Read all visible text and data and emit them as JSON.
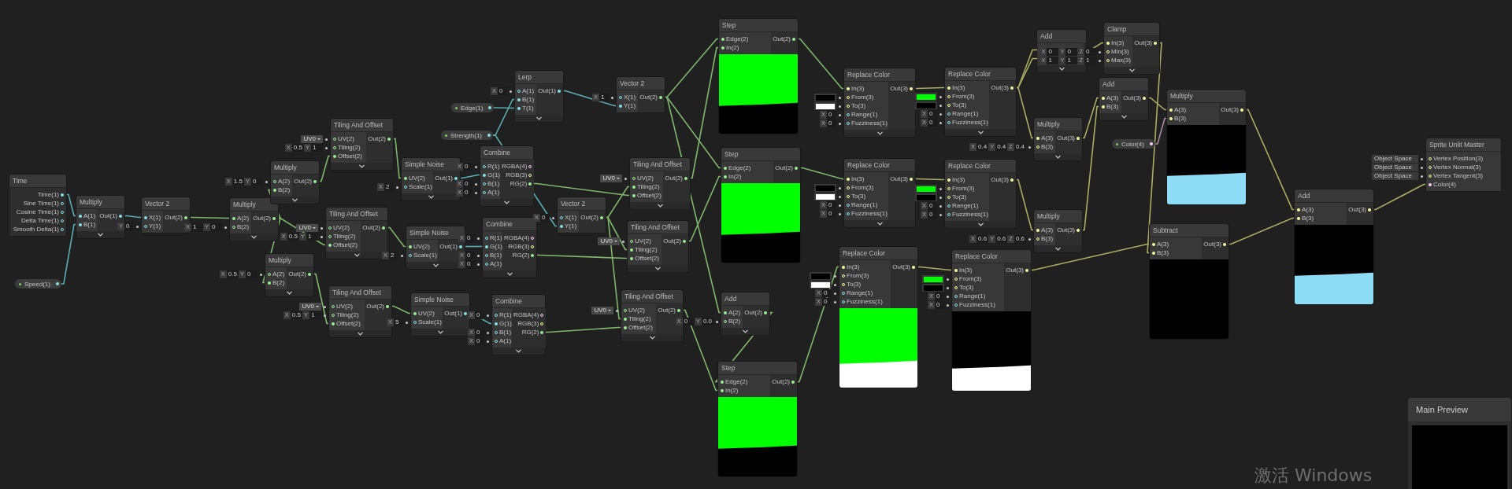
{
  "nodes": [
    {
      "title": "Time",
      "collapsible": false,
      "outputs": [
        {
          "label": "Time(1)",
          "kind": "float",
          "connected": true
        },
        {
          "label": "Sine Time(1)",
          "kind": "float",
          "connected": false
        },
        {
          "label": "Cosine Time(1)",
          "kind": "float",
          "connected": false
        },
        {
          "label": "Delta Time(1)",
          "kind": "float",
          "connected": false
        },
        {
          "label": "Smooth Delta(1)",
          "kind": "float",
          "connected": false
        }
      ]
    },
    {
      "title": "Multiply",
      "collapsible": true,
      "inputs": [
        {
          "label": "A(1)",
          "kind": "float",
          "connected": true
        },
        {
          "label": "B(1)",
          "kind": "float",
          "connected": true
        }
      ],
      "outputs": [
        {
          "label": "Out(1)",
          "kind": "float",
          "connected": true
        }
      ]
    },
    {
      "title": "Vector 2",
      "collapsible": false,
      "inputs": [
        {
          "label": "X(1)",
          "kind": "float",
          "connected": true
        },
        {
          "label": "Y(1)",
          "kind": "float",
          "connected": false,
          "field": {
            "kind": "vector",
            "parts": [
              {
                "axis": "Y",
                "value": "0"
              }
            ]
          }
        }
      ],
      "outputs": [
        {
          "label": "Out(2)",
          "kind": "vec2",
          "connected": true
        }
      ]
    },
    {
      "title": "Multiply",
      "collapsible": true,
      "inputs": [
        {
          "label": "A(2)",
          "kind": "vec2",
          "connected": true
        },
        {
          "label": "B(2)",
          "kind": "vec2",
          "connected": false,
          "field": {
            "kind": "vector",
            "parts": [
              {
                "axis": "X",
                "value": "1"
              },
              {
                "axis": "Y",
                "value": "0"
              }
            ]
          }
        }
      ],
      "outputs": [
        {
          "label": "Out(2)",
          "kind": "vec2",
          "connected": true
        }
      ]
    },
    {
      "title": "Multiply",
      "collapsible": true,
      "inputs": [
        {
          "label": "A(2)",
          "kind": "vec2",
          "connected": false,
          "field": {
            "kind": "vector",
            "parts": [
              {
                "axis": "X",
                "value": "1.5"
              },
              {
                "axis": "Y",
                "value": "0"
              }
            ]
          }
        },
        {
          "label": "B(2)",
          "kind": "vec2",
          "connected": true
        }
      ],
      "outputs": [
        {
          "label": "Out(2)",
          "kind": "vec2",
          "connected": true
        }
      ]
    },
    {
      "title": "Tiling And Offset",
      "collapsible": true,
      "inputs": [
        {
          "label": "UV(2)",
          "kind": "vec2",
          "connected": false,
          "field": {
            "kind": "dropdown",
            "value": "UV0"
          }
        },
        {
          "label": "Tiling(2)",
          "kind": "vec2",
          "connected": false,
          "field": {
            "kind": "vector",
            "parts": [
              {
                "axis": "X",
                "value": "0.5"
              },
              {
                "axis": "Y",
                "value": "1"
              }
            ]
          }
        },
        {
          "label": "Offset(2)",
          "kind": "vec2",
          "connected": true
        }
      ],
      "outputs": [
        {
          "label": "Out(2)",
          "kind": "vec2",
          "connected": true
        }
      ]
    },
    {
      "title": "Simple Noise",
      "collapsible": true,
      "inputs": [
        {
          "label": "UV(2)",
          "kind": "vec2",
          "connected": true
        },
        {
          "label": "Scale(1)",
          "kind": "float",
          "connected": false,
          "field": {
            "kind": "vector",
            "parts": [
              {
                "axis": "X",
                "value": "2"
              }
            ]
          }
        }
      ],
      "outputs": [
        {
          "label": "Out(1)",
          "kind": "float",
          "connected": true
        }
      ]
    },
    {
      "title": "Tiling And Offset",
      "collapsible": true,
      "inputs": [
        {
          "label": "UV(2)",
          "kind": "vec2",
          "connected": false,
          "field": {
            "kind": "dropdown",
            "value": "UV0"
          }
        },
        {
          "label": "Tiling(2)",
          "kind": "vec2",
          "connected": false,
          "field": {
            "kind": "vector",
            "parts": [
              {
                "axis": "X",
                "value": "0.5"
              },
              {
                "axis": "Y",
                "value": "1"
              }
            ]
          }
        },
        {
          "label": "Offset(2)",
          "kind": "vec2",
          "connected": true
        }
      ],
      "outputs": [
        {
          "label": "Out(2)",
          "kind": "vec2",
          "connected": true
        }
      ]
    },
    {
      "title": "Simple Noise",
      "collapsible": true,
      "inputs": [
        {
          "label": "UV(2)",
          "kind": "vec2",
          "connected": true
        },
        {
          "label": "Scale(1)",
          "kind": "float",
          "connected": false,
          "field": {
            "kind": "vector",
            "parts": [
              {
                "axis": "X",
                "value": "2"
              }
            ]
          }
        }
      ],
      "outputs": [
        {
          "label": "Out(1)",
          "kind": "float",
          "connected": true
        }
      ]
    },
    {
      "title": "Multiply",
      "collapsible": true,
      "inputs": [
        {
          "label": "A(2)",
          "kind": "vec2",
          "connected": false,
          "field": {
            "kind": "vector",
            "parts": [
              {
                "axis": "X",
                "value": "0.5"
              },
              {
                "axis": "Y",
                "value": "0"
              }
            ]
          }
        },
        {
          "label": "B(2)",
          "kind": "vec2",
          "connected": true
        }
      ],
      "outputs": [
        {
          "label": "Out(2)",
          "kind": "vec2",
          "connected": true
        }
      ]
    },
    {
      "title": "Tiling And Offset",
      "collapsible": true,
      "inputs": [
        {
          "label": "UV(2)",
          "kind": "vec2",
          "connected": false,
          "field": {
            "kind": "dropdown",
            "value": "UV0"
          }
        },
        {
          "label": "Tiling(2)",
          "kind": "vec2",
          "connected": false,
          "field": {
            "kind": "vector",
            "parts": [
              {
                "axis": "X",
                "value": "0.5"
              },
              {
                "axis": "Y",
                "value": "1"
              }
            ]
          }
        },
        {
          "label": "Offset(2)",
          "kind": "vec2",
          "connected": true
        }
      ],
      "outputs": [
        {
          "label": "Out(2)",
          "kind": "vec2",
          "connected": true
        }
      ]
    },
    {
      "title": "Simple Noise",
      "collapsible": true,
      "inputs": [
        {
          "label": "UV(2)",
          "kind": "vec2",
          "connected": true
        },
        {
          "label": "Scale(1)",
          "kind": "float",
          "connected": false,
          "field": {
            "kind": "vector",
            "parts": [
              {
                "axis": "X",
                "value": "5"
              }
            ]
          }
        }
      ],
      "outputs": [
        {
          "label": "Out(1)",
          "kind": "float",
          "connected": true
        }
      ]
    },
    {
      "title": "Lerp",
      "collapsible": true,
      "inputs": [
        {
          "label": "A(1)",
          "kind": "float",
          "connected": false,
          "field": {
            "kind": "vector",
            "parts": [
              {
                "axis": "X",
                "value": "0"
              }
            ]
          }
        },
        {
          "label": "B(1)",
          "kind": "float",
          "connected": true
        },
        {
          "label": "T(1)",
          "kind": "float",
          "connected": true
        }
      ],
      "outputs": [
        {
          "label": "Out(1)",
          "kind": "float",
          "connected": true
        }
      ]
    },
    {
      "title": "Vector 2",
      "collapsible": false,
      "inputs": [
        {
          "label": "X(1)",
          "kind": "float",
          "connected": false,
          "field": {
            "kind": "vector",
            "parts": [
              {
                "axis": "X",
                "value": "1"
              }
            ]
          }
        },
        {
          "label": "Y(1)",
          "kind": "float",
          "connected": true
        }
      ],
      "outputs": [
        {
          "label": "Out(2)",
          "kind": "vec2",
          "connected": true
        }
      ]
    },
    {
      "title": "Combine",
      "collapsible": true,
      "inputs": [
        {
          "label": "R(1)",
          "kind": "float",
          "connected": false,
          "field": {
            "kind": "vector",
            "parts": [
              {
                "axis": "X",
                "value": "0"
              }
            ]
          }
        },
        {
          "label": "G(1)",
          "kind": "float",
          "connected": true
        },
        {
          "label": "B(1)",
          "kind": "float",
          "connected": false,
          "field": {
            "kind": "vector",
            "parts": [
              {
                "axis": "X",
                "value": "0"
              }
            ]
          }
        },
        {
          "label": "A(1)",
          "kind": "float",
          "connected": false,
          "field": {
            "kind": "vector",
            "parts": [
              {
                "axis": "X",
                "value": "0"
              }
            ]
          }
        }
      ],
      "outputs": [
        {
          "label": "RGBA(4)",
          "kind": "vec4",
          "connected": false
        },
        {
          "label": "RGB(3)",
          "kind": "vec3",
          "connected": false
        },
        {
          "label": "RG(2)",
          "kind": "vec2",
          "connected": true
        }
      ]
    },
    {
      "title": "Vector 2",
      "collapsible": false,
      "inputs": [
        {
          "label": "X(1)",
          "kind": "float",
          "connected": false,
          "field": {
            "kind": "vector",
            "parts": [
              {
                "axis": "X",
                "value": "0"
              }
            ]
          }
        },
        {
          "label": "Y(1)",
          "kind": "float",
          "connected": true
        }
      ],
      "outputs": [
        {
          "label": "Out(2)",
          "kind": "vec2",
          "connected": true
        }
      ]
    },
    {
      "title": "Combine",
      "collapsible": true,
      "inputs": [
        {
          "label": "R(1)",
          "kind": "float",
          "connected": false,
          "field": {
            "kind": "vector",
            "parts": [
              {
                "axis": "X",
                "value": "0"
              }
            ]
          }
        },
        {
          "label": "G(1)",
          "kind": "float",
          "connected": true
        },
        {
          "label": "B(1)",
          "kind": "float",
          "connected": false,
          "field": {
            "kind": "vector",
            "parts": [
              {
                "axis": "X",
                "value": "0"
              }
            ]
          }
        },
        {
          "label": "A(1)",
          "kind": "float",
          "connected": false,
          "field": {
            "kind": "vector",
            "parts": [
              {
                "axis": "X",
                "value": "0"
              }
            ]
          }
        }
      ],
      "outputs": [
        {
          "label": "RGBA(4)",
          "kind": "vec4",
          "connected": false
        },
        {
          "label": "RGB(3)",
          "kind": "vec3",
          "connected": false
        },
        {
          "label": "RG(2)",
          "kind": "vec2",
          "connected": true
        }
      ]
    },
    {
      "title": "Combine",
      "collapsible": true,
      "inputs": [
        {
          "label": "R(1)",
          "kind": "float",
          "connected": false,
          "field": {
            "kind": "vector",
            "parts": [
              {
                "axis": "X",
                "value": "0"
              }
            ]
          }
        },
        {
          "label": "G(1)",
          "kind": "float",
          "connected": true
        },
        {
          "label": "B(1)",
          "kind": "float",
          "connected": false,
          "field": {
            "kind": "vector",
            "parts": [
              {
                "axis": "X",
                "value": "0"
              }
            ]
          }
        },
        {
          "label": "A(1)",
          "kind": "float",
          "connected": false,
          "field": {
            "kind": "vector",
            "parts": [
              {
                "axis": "X",
                "value": "0"
              }
            ]
          }
        }
      ],
      "outputs": [
        {
          "label": "RGBA(4)",
          "kind": "vec4",
          "connected": false
        },
        {
          "label": "RGB(3)",
          "kind": "vec3",
          "connected": false
        },
        {
          "label": "RG(2)",
          "kind": "vec2",
          "connected": true
        }
      ]
    },
    {
      "title": "Tiling And Offset",
      "collapsible": true,
      "inputs": [
        {
          "label": "UV(2)",
          "kind": "vec2",
          "connected": false,
          "field": {
            "kind": "dropdown",
            "value": "UV0"
          }
        },
        {
          "label": "Tiling(2)",
          "kind": "vec2",
          "connected": true
        },
        {
          "label": "Offset(2)",
          "kind": "vec2",
          "connected": true
        }
      ],
      "outputs": [
        {
          "label": "Out(2)",
          "kind": "vec2",
          "connected": true
        }
      ]
    },
    {
      "title": "Tiling And Offset",
      "collapsible": true,
      "inputs": [
        {
          "label": "UV(2)",
          "kind": "vec2",
          "connected": false,
          "field": {
            "kind": "dropdown",
            "value": "UV0"
          }
        },
        {
          "label": "Tiling(2)",
          "kind": "vec2",
          "connected": true
        },
        {
          "label": "Offset(2)",
          "kind": "vec2",
          "connected": true
        }
      ],
      "outputs": [
        {
          "label": "Out(2)",
          "kind": "vec2",
          "connected": true
        }
      ]
    },
    {
      "title": "Tiling And Offset",
      "collapsible": true,
      "inputs": [
        {
          "label": "UV(2)",
          "kind": "vec2",
          "connected": false,
          "field": {
            "kind": "dropdown",
            "value": "UV0"
          }
        },
        {
          "label": "Tiling(2)",
          "kind": "vec2",
          "connected": true
        },
        {
          "label": "Offset(2)",
          "kind": "vec2",
          "connected": true
        }
      ],
      "outputs": [
        {
          "label": "Out(2)",
          "kind": "vec2",
          "connected": true
        }
      ]
    },
    {
      "title": "Step",
      "collapsible": false,
      "preview": {
        "kind": "green_black"
      },
      "inputs": [
        {
          "label": "Edge(2)",
          "kind": "vec2",
          "connected": true
        },
        {
          "label": "In(2)",
          "kind": "vec2",
          "connected": true
        }
      ],
      "outputs": [
        {
          "label": "Out(2)",
          "kind": "vec2",
          "connected": true
        }
      ]
    },
    {
      "title": "Step",
      "collapsible": false,
      "preview": {
        "kind": "green_black"
      },
      "inputs": [
        {
          "label": "Edge(2)",
          "kind": "vec2",
          "connected": true
        },
        {
          "label": "In(2)",
          "kind": "vec2",
          "connected": true
        }
      ],
      "outputs": [
        {
          "label": "Out(2)",
          "kind": "vec2",
          "connected": true
        }
      ]
    },
    {
      "title": "Add",
      "collapsible": true,
      "inputs": [
        {
          "label": "A(2)",
          "kind": "vec2",
          "connected": true
        },
        {
          "label": "B(2)",
          "kind": "vec2",
          "connected": false,
          "field": {
            "kind": "vector",
            "parts": [
              {
                "axis": "X",
                "value": "0"
              },
              {
                "axis": "Y",
                "value": "0.0"
              }
            ]
          }
        }
      ],
      "outputs": [
        {
          "label": "Out(2)",
          "kind": "vec2",
          "connected": true
        }
      ]
    },
    {
      "title": "Step",
      "collapsible": false,
      "preview": {
        "kind": "green_black"
      },
      "inputs": [
        {
          "label": "Edge(2)",
          "kind": "vec2",
          "connected": true
        },
        {
          "label": "In(2)",
          "kind": "vec2",
          "connected": true
        }
      ],
      "outputs": [
        {
          "label": "Out(2)",
          "kind": "vec2",
          "connected": true
        }
      ]
    },
    {
      "title": "Replace Color",
      "collapsible": true,
      "inputs": [
        {
          "label": "In(3)",
          "kind": "vec3",
          "connected": true
        },
        {
          "label": "From(3)",
          "kind": "vec3",
          "connected": false,
          "field": {
            "kind": "swatch",
            "color": "#000000"
          }
        },
        {
          "label": "To(3)",
          "kind": "vec3",
          "connected": false,
          "field": {
            "kind": "swatch",
            "color": "#ffffff"
          }
        },
        {
          "label": "Range(1)",
          "kind": "float",
          "connected": false,
          "field": {
            "kind": "vector",
            "parts": [
              {
                "axis": "X",
                "value": "0"
              }
            ]
          }
        },
        {
          "label": "Fuzziness(1)",
          "kind": "float",
          "connected": false,
          "field": {
            "kind": "vector",
            "parts": [
              {
                "axis": "X",
                "value": "0"
              }
            ]
          }
        }
      ],
      "outputs": [
        {
          "label": "Out(3)",
          "kind": "vec3",
          "connected": true
        }
      ]
    },
    {
      "title": "Replace Color",
      "collapsible": true,
      "inputs": [
        {
          "label": "In(3)",
          "kind": "vec3",
          "connected": true
        },
        {
          "label": "From(3)",
          "kind": "vec3",
          "connected": false,
          "field": {
            "kind": "swatch",
            "color": "#00ff00"
          }
        },
        {
          "label": "To(3)",
          "kind": "vec3",
          "connected": false,
          "field": {
            "kind": "swatch",
            "color": "#000000"
          }
        },
        {
          "label": "Range(1)",
          "kind": "float",
          "connected": false,
          "field": {
            "kind": "vector",
            "parts": [
              {
                "axis": "X",
                "value": "0"
              }
            ]
          }
        },
        {
          "label": "Fuzziness(1)",
          "kind": "float",
          "connected": false,
          "field": {
            "kind": "vector",
            "parts": [
              {
                "axis": "X",
                "value": "0"
              }
            ]
          }
        }
      ],
      "outputs": [
        {
          "label": "Out(3)",
          "kind": "vec3",
          "connected": true
        }
      ]
    },
    {
      "title": "Replace Color",
      "collapsible": true,
      "inputs": [
        {
          "label": "In(3)",
          "kind": "vec3",
          "connected": true
        },
        {
          "label": "From(3)",
          "kind": "vec3",
          "connected": false,
          "field": {
            "kind": "swatch",
            "color": "#000000"
          }
        },
        {
          "label": "To(3)",
          "kind": "vec3",
          "connected": false,
          "field": {
            "kind": "swatch",
            "color": "#ffffff"
          }
        },
        {
          "label": "Range(1)",
          "kind": "float",
          "connected": false,
          "field": {
            "kind": "vector",
            "parts": [
              {
                "axis": "X",
                "value": "0"
              }
            ]
          }
        },
        {
          "label": "Fuzziness(1)",
          "kind": "float",
          "connected": false,
          "field": {
            "kind": "vector",
            "parts": [
              {
                "axis": "X",
                "value": "0"
              }
            ]
          }
        }
      ],
      "outputs": [
        {
          "label": "Out(3)",
          "kind": "vec3",
          "connected": true
        }
      ]
    },
    {
      "title": "Replace Color",
      "collapsible": true,
      "inputs": [
        {
          "label": "In(3)",
          "kind": "vec3",
          "connected": true
        },
        {
          "label": "From(3)",
          "kind": "vec3",
          "connected": false,
          "field": {
            "kind": "swatch",
            "color": "#00ff00"
          }
        },
        {
          "label": "To(3)",
          "kind": "vec3",
          "connected": false,
          "field": {
            "kind": "swatch",
            "color": "#000000"
          }
        },
        {
          "label": "Range(1)",
          "kind": "float",
          "connected": false,
          "field": {
            "kind": "vector",
            "parts": [
              {
                "axis": "X",
                "value": "0"
              }
            ]
          }
        },
        {
          "label": "Fuzziness(1)",
          "kind": "float",
          "connected": false,
          "field": {
            "kind": "vector",
            "parts": [
              {
                "axis": "X",
                "value": "0"
              }
            ]
          }
        }
      ],
      "outputs": [
        {
          "label": "Out(3)",
          "kind": "vec3",
          "connected": true
        }
      ]
    },
    {
      "title": "Replace Color",
      "collapsible": false,
      "preview": {
        "kind": "green_white"
      },
      "inputs": [
        {
          "label": "In(3)",
          "kind": "vec3",
          "connected": true
        },
        {
          "label": "From(3)",
          "kind": "vec3",
          "connected": false,
          "field": {
            "kind": "swatch",
            "color": "#000000"
          }
        },
        {
          "label": "To(3)",
          "kind": "vec3",
          "connected": false,
          "field": {
            "kind": "swatch",
            "color": "#ffffff"
          }
        },
        {
          "label": "Range(1)",
          "kind": "float",
          "connected": false,
          "field": {
            "kind": "vector",
            "parts": [
              {
                "axis": "X",
                "value": "0"
              }
            ]
          }
        },
        {
          "label": "Fuzziness(1)",
          "kind": "float",
          "connected": false,
          "field": {
            "kind": "vector",
            "parts": [
              {
                "axis": "X",
                "value": "0"
              }
            ]
          }
        }
      ],
      "outputs": [
        {
          "label": "Out(3)",
          "kind": "vec3",
          "connected": true
        }
      ]
    },
    {
      "title": "Replace Color",
      "collapsible": false,
      "preview": {
        "kind": "black_white"
      },
      "inputs": [
        {
          "label": "In(3)",
          "kind": "vec3",
          "connected": true
        },
        {
          "label": "From(3)",
          "kind": "vec3",
          "connected": false,
          "field": {
            "kind": "swatch",
            "color": "#00ff00"
          }
        },
        {
          "label": "To(3)",
          "kind": "vec3",
          "connected": false,
          "field": {
            "kind": "swatch",
            "color": "#000000"
          }
        },
        {
          "label": "Range(1)",
          "kind": "float",
          "connected": false,
          "field": {
            "kind": "vector",
            "parts": [
              {
                "axis": "X",
                "value": "0"
              }
            ]
          }
        },
        {
          "label": "Fuzziness(1)",
          "kind": "float",
          "connected": false,
          "field": {
            "kind": "vector",
            "parts": [
              {
                "axis": "X",
                "value": "0"
              }
            ]
          }
        }
      ],
      "outputs": [
        {
          "label": "Out(3)",
          "kind": "vec3",
          "connected": true
        }
      ]
    },
    {
      "title": "Add",
      "collapsible": true
    },
    {
      "title": "Clamp",
      "collapsible": true,
      "inputs": [
        {
          "label": "In(3)",
          "kind": "vec3",
          "connected": true
        },
        {
          "label": "Min(3)",
          "kind": "vec3",
          "connected": false,
          "field": {
            "kind": "vector",
            "parts": [
              {
                "axis": "X",
                "value": "0"
              },
              {
                "axis": "Y",
                "value": "0"
              },
              {
                "axis": "Z",
                "value": "0"
              }
            ]
          }
        },
        {
          "label": "Max(3)",
          "kind": "vec3",
          "connected": false,
          "field": {
            "kind": "vector",
            "parts": [
              {
                "axis": "X",
                "value": "1"
              },
              {
                "axis": "Y",
                "value": "1"
              },
              {
                "axis": "Z",
                "value": "1"
              }
            ]
          }
        }
      ],
      "outputs": [
        {
          "label": "Out(3)",
          "kind": "vec3",
          "connected": true
        }
      ]
    },
    {
      "title": "Add",
      "collapsible": true,
      "inputs": [
        {
          "label": "A(3)",
          "kind": "vec3",
          "connected": true
        },
        {
          "label": "B(3)",
          "kind": "vec3",
          "connected": true
        }
      ],
      "outputs": [
        {
          "label": "Out(3)",
          "kind": "vec3",
          "connected": true
        }
      ]
    },
    {
      "title": "Multiply",
      "collapsible": true,
      "inputs": [
        {
          "label": "A(3)",
          "kind": "vec3",
          "connected": true
        },
        {
          "label": "B(3)",
          "kind": "vec3",
          "connected": false,
          "field": {
            "kind": "vector",
            "parts": [
              {
                "axis": "X",
                "value": "0.4"
              },
              {
                "axis": "Y",
                "value": "0.4"
              },
              {
                "axis": "Z",
                "value": "0.4"
              }
            ]
          }
        }
      ],
      "outputs": [
        {
          "label": "Out(3)",
          "kind": "vec3",
          "connected": true
        }
      ]
    },
    {
      "title": "Multiply",
      "collapsible": true,
      "inputs": [
        {
          "label": "A(3)",
          "kind": "vec3",
          "connected": true
        },
        {
          "label": "B(3)",
          "kind": "vec3",
          "connected": false,
          "field": {
            "kind": "vector",
            "parts": [
              {
                "axis": "X",
                "value": "0.6"
              },
              {
                "axis": "Y",
                "value": "0.6"
              },
              {
                "axis": "Z",
                "value": "0.6"
              }
            ]
          }
        }
      ],
      "outputs": [
        {
          "label": "Out(3)",
          "kind": "vec3",
          "connected": true
        }
      ]
    },
    {
      "title": "Multiply",
      "collapsible": false,
      "preview": {
        "kind": "black_blue"
      },
      "inputs": [
        {
          "label": "A(3)",
          "kind": "vec3",
          "connected": true
        },
        {
          "label": "B(3)",
          "kind": "vec3",
          "connected": true
        }
      ],
      "outputs": [
        {
          "label": "Out(3)",
          "kind": "vec3",
          "connected": true
        }
      ]
    },
    {
      "title": "Subtract",
      "collapsible": false,
      "preview": {
        "kind": "black"
      },
      "inputs": [
        {
          "label": "A(3)",
          "kind": "vec3",
          "connected": true
        },
        {
          "label": "B(3)",
          "kind": "vec3",
          "connected": true
        }
      ],
      "outputs": [
        {
          "label": "Out(3)",
          "kind": "vec3",
          "connected": true
        }
      ]
    },
    {
      "title": "Add",
      "collapsible": false,
      "preview": {
        "kind": "black_blue"
      },
      "inputs": [
        {
          "label": "A(3)",
          "kind": "vec3",
          "connected": true
        },
        {
          "label": "B(3)",
          "kind": "vec3",
          "connected": true
        }
      ],
      "outputs": [
        {
          "label": "Out(3)",
          "kind": "vec3",
          "connected": true
        }
      ]
    },
    {
      "title": "Sprite Unlit Master",
      "collapsible": false,
      "inputs": [
        {
          "label": "Vertex Position(3)",
          "kind": "vec3",
          "connected": false,
          "field": {
            "kind": "space",
            "value": "Object Space"
          }
        },
        {
          "label": "Vertex Normal(3)",
          "kind": "vec3",
          "connected": false,
          "field": {
            "kind": "space",
            "value": "Object Space"
          }
        },
        {
          "label": "Vertex Tangent(3)",
          "kind": "vec3",
          "connected": false,
          "field": {
            "kind": "space",
            "value": "Object Space"
          }
        },
        {
          "label": "Color(4)",
          "kind": "vec4",
          "connected": true
        }
      ]
    }
  ],
  "properties": [
    {
      "label": "Speed(1)",
      "kind": "float"
    },
    {
      "label": "Edge(1)",
      "kind": "float"
    },
    {
      "label": "Strength(1)",
      "kind": "float"
    },
    {
      "label": "Color(4)",
      "kind": "vec4"
    }
  ],
  "main_preview": {
    "title": "Main Preview"
  },
  "os_overlay": {
    "text": "激活 Windows"
  }
}
